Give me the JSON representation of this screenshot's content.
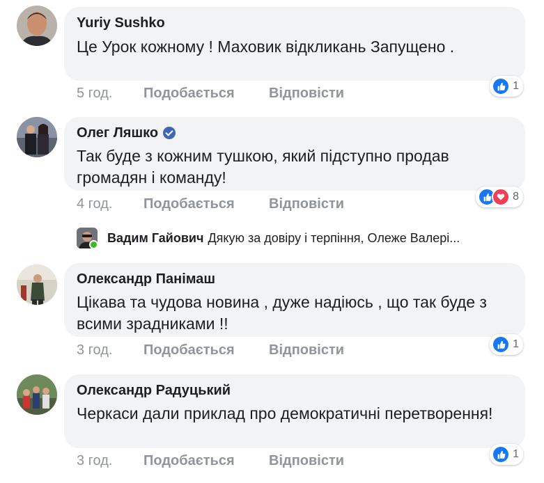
{
  "comments": [
    {
      "author": "Yuriy Sushko",
      "text": "Це Урок кожному ! Маховик відкликань Запущено .",
      "time": "5 год.",
      "like_label": "Подобається",
      "reply_label": "Відповісти",
      "reaction_count": "1",
      "reactions": [
        "like-icon"
      ]
    },
    {
      "author": "Олег Ляшко",
      "verified": true,
      "text": "Так буде з кожним тушкою, який підступно продав громадян і команду!",
      "time": "4 год.",
      "like_label": "Подобається",
      "reply_label": "Відповісти",
      "reaction_count": "8",
      "reactions": [
        "like-icon",
        "love-icon"
      ]
    },
    {
      "author": "Олександр Панімаш",
      "text": "Цікава та чудова новина , дуже надіюсь , що так буде з всими зрадниками !!",
      "time": "3 год.",
      "like_label": "Подобається",
      "reply_label": "Відповісти",
      "reaction_count": "1",
      "reactions": [
        "like-icon"
      ]
    },
    {
      "author": "Олександр Радуцький",
      "text": "Черкаси дали приклад про демократичні перетворення!",
      "time": "3 год.",
      "like_label": "Подобається",
      "reply_label": "Відповісти",
      "reaction_count": "1",
      "reactions": [
        "like-icon"
      ]
    }
  ],
  "reply_preview": {
    "author": "Вадим Гайович",
    "text": "Дякую за довіру і терпіння, Олеже Валері..."
  },
  "colors": {
    "bubble": "#f2f3f5",
    "meta_text": "#90949c",
    "like_blue": "#1877f2",
    "love_red": "#f33e58",
    "verified_blue": "#4267b2",
    "online_green": "#42b72a"
  }
}
